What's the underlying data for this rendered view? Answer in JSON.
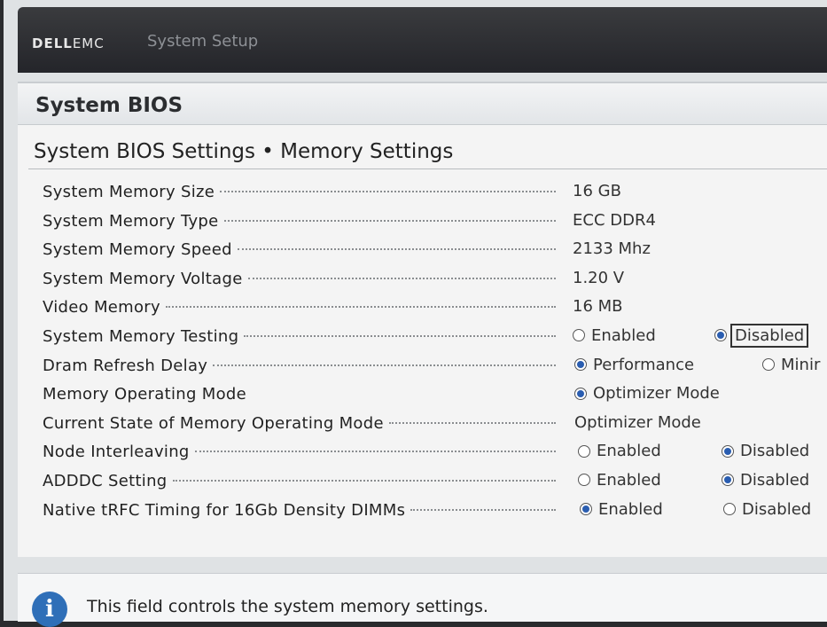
{
  "header": {
    "brand_bold": "DELL",
    "brand_light": "EMC",
    "app_title": "System Setup"
  },
  "panel": {
    "title": "System BIOS",
    "page_title": "System BIOS Settings • Memory Settings"
  },
  "rows": [
    {
      "label": "System Memory Size",
      "value": "16 GB"
    },
    {
      "label": "System Memory Type",
      "value": "ECC DDR4"
    },
    {
      "label": "System Memory Speed",
      "value": "2133 Mhz"
    },
    {
      "label": "System Memory Voltage",
      "value": "1.20 V"
    },
    {
      "label": "Video Memory",
      "value": "16 MB"
    },
    {
      "label": "System Memory Testing",
      "opt1": "Enabled",
      "opt2": "Disabled"
    },
    {
      "label": "Dram Refresh Delay",
      "opt1": "Performance",
      "opt2": "Minir"
    },
    {
      "label": "Memory Operating Mode",
      "opt1": "Optimizer Mode"
    },
    {
      "label": "Current State of Memory Operating Mode",
      "value": "Optimizer Mode"
    },
    {
      "label": "Node Interleaving",
      "opt1": "Enabled",
      "opt2": "Disabled"
    },
    {
      "label": "ADDDC Setting",
      "opt1": "Enabled",
      "opt2": "Disabled"
    },
    {
      "label": "Native tRFC Timing for 16Gb Density DIMMs",
      "opt1": "Enabled",
      "opt2": "Disabled"
    }
  ],
  "info": {
    "icon": "info-icon",
    "text": "This field controls the system memory settings."
  },
  "colors": {
    "header_bg": "#2b2c30",
    "radio_selected": "#2a5db0",
    "info_icon": "#2f6fb8"
  }
}
